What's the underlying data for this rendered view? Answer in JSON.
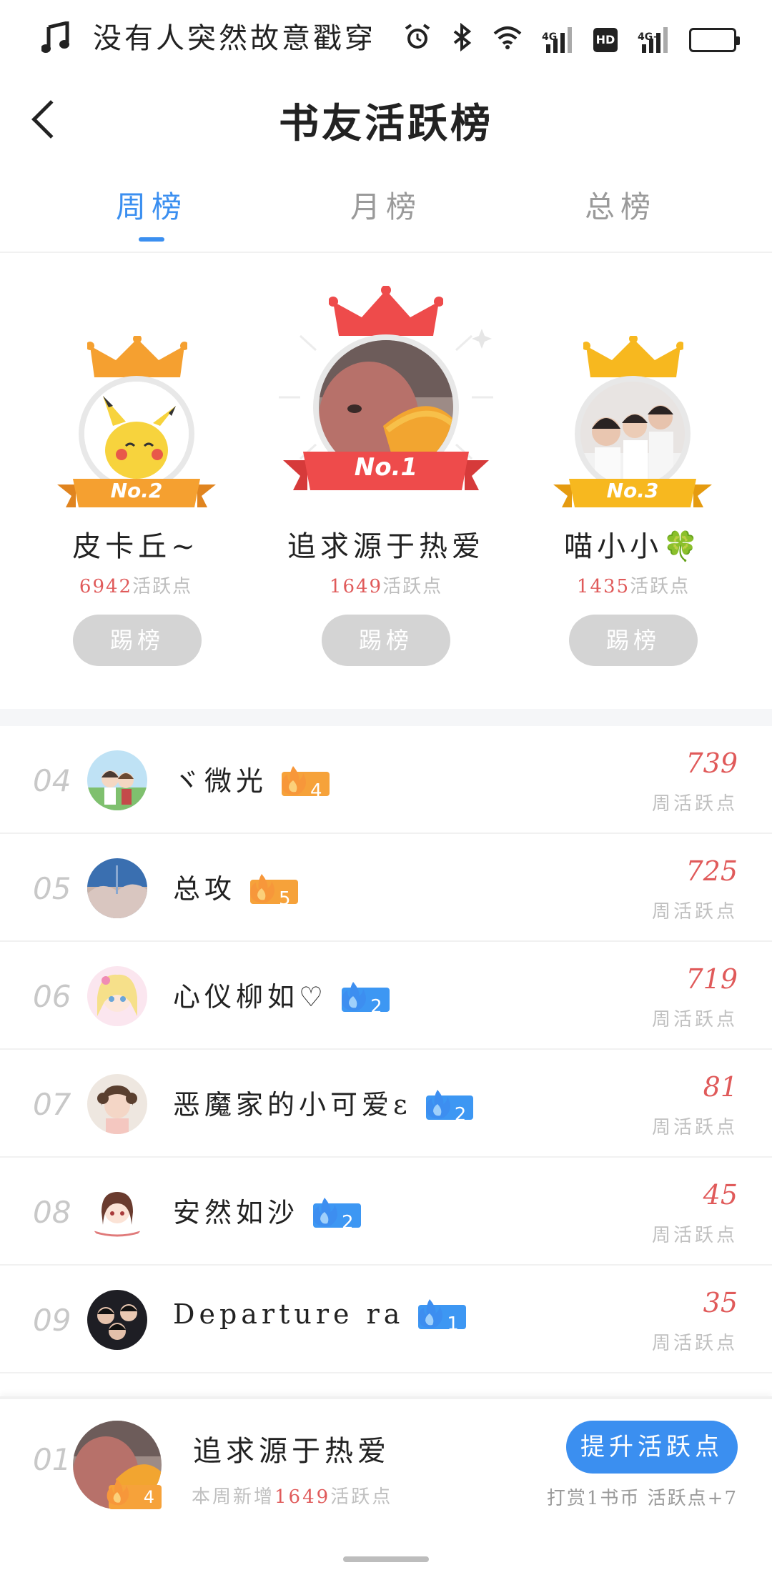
{
  "status_bar": {
    "marquee": "没有人突然故意戳穿",
    "icons": [
      "music-icon",
      "alarm-icon",
      "bluetooth-icon",
      "wifi-icon",
      "signal-4g-icon",
      "hd-icon",
      "signal-4g-plus-icon",
      "battery-icon"
    ],
    "labels": {
      "net1": "4G",
      "hd": "HD",
      "net2": "4G+"
    }
  },
  "header": {
    "title": "书友活跃榜"
  },
  "tabs": [
    {
      "label": "周榜",
      "active": true
    },
    {
      "label": "月榜",
      "active": false
    },
    {
      "label": "总榜",
      "active": false
    }
  ],
  "podium": [
    {
      "place": "No.2",
      "name": "皮卡丘~",
      "score": "6942",
      "unit": "活跃点",
      "action": "踢榜"
    },
    {
      "place": "No.1",
      "name": "追求源于热爱",
      "score": "1649",
      "unit": "活跃点",
      "action": "踢榜"
    },
    {
      "place": "No.3",
      "name": "喵小小🍀",
      "score": "1435",
      "unit": "活跃点",
      "action": "踢榜"
    }
  ],
  "list": [
    {
      "rank": "04",
      "name": "ヾ微光",
      "level": "4",
      "level_color": "orange",
      "score": "739",
      "unit": "周活跃点"
    },
    {
      "rank": "05",
      "name": "总攻",
      "level": "5",
      "level_color": "orange",
      "score": "725",
      "unit": "周活跃点"
    },
    {
      "rank": "06",
      "name": "心仪柳如♡",
      "level": "2",
      "level_color": "blue",
      "score": "719",
      "unit": "周活跃点"
    },
    {
      "rank": "07",
      "name": "恶魔家的小可爱ε",
      "level": "2",
      "level_color": "blue",
      "score": "81",
      "unit": "周活跃点"
    },
    {
      "rank": "08",
      "name": "安然如沙",
      "level": "2",
      "level_color": "blue",
      "score": "45",
      "unit": "周活跃点"
    },
    {
      "rank": "09",
      "name": "Departure ra",
      "level": "1",
      "level_color": "blue",
      "score": "35",
      "unit": "周活跃点"
    }
  ],
  "me": {
    "rank": "01",
    "name": "追求源于热爱",
    "level": "4",
    "sub_prefix": "本周新增",
    "sub_score": "1649",
    "sub_suffix": "活跃点",
    "boost_label": "提升活跃点",
    "reward_text": "打赏1书币 活跃点+7"
  },
  "colors": {
    "accent": "#3b8ff0",
    "score_red": "#e05a5a",
    "orange_badge": "#f6a23a",
    "blue_badge": "#3d97f3",
    "battery": "#f5b72f"
  }
}
